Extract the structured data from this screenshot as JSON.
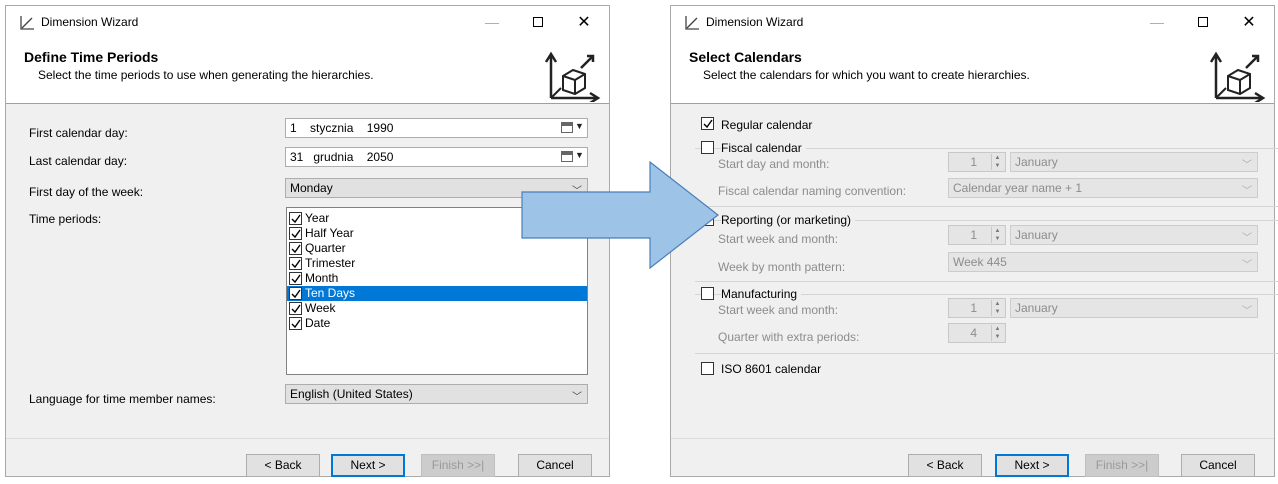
{
  "wizard1": {
    "window_title": "Dimension Wizard",
    "header_title": "Define Time Periods",
    "header_subtitle": "Select the time periods to use when generating the hierarchies.",
    "first_day": {
      "label": "First calendar day:",
      "day": "1",
      "month": "stycznia",
      "year": "1990"
    },
    "last_day": {
      "label": "Last calendar day:",
      "day": "31",
      "month": "grudnia",
      "year": "2050"
    },
    "first_day_of_week": {
      "label": "First day of the week:",
      "value": "Monday"
    },
    "time_periods": {
      "label": "Time periods:",
      "items": [
        {
          "label": "Year",
          "checked": true
        },
        {
          "label": "Half Year",
          "checked": true
        },
        {
          "label": "Quarter",
          "checked": true
        },
        {
          "label": "Trimester",
          "checked": true
        },
        {
          "label": "Month",
          "checked": true
        },
        {
          "label": "Ten Days",
          "checked": true,
          "selected": true
        },
        {
          "label": "Week",
          "checked": true
        },
        {
          "label": "Date",
          "checked": true
        }
      ]
    },
    "language": {
      "label": "Language for time member names:",
      "value": "English (United States)"
    },
    "buttons": {
      "back": "< Back",
      "next": "Next >",
      "finish": "Finish >>|",
      "cancel": "Cancel"
    }
  },
  "wizard2": {
    "window_title": "Dimension Wizard",
    "header_title": "Select Calendars",
    "header_subtitle": "Select the calendars for which you want to create hierarchies.",
    "regular": {
      "label": "Regular calendar",
      "checked": true
    },
    "fiscal": {
      "label": "Fiscal calendar",
      "checked": false,
      "start_label": "Start day and month:",
      "start_day": "1",
      "start_month": "January",
      "naming_label": "Fiscal calendar naming convention:",
      "naming_value": "Calendar year name + 1"
    },
    "reporting": {
      "label": "Reporting (or marketing)",
      "checked": false,
      "start_label": "Start week and month:",
      "start_week": "1",
      "start_month": "January",
      "pattern_label": "Week by month pattern:",
      "pattern_value": "Week 445"
    },
    "manufacturing": {
      "label": "Manufacturing",
      "checked": false,
      "start_label": "Start week and month:",
      "start_week": "1",
      "start_month": "January",
      "quarter_label": "Quarter with extra periods:",
      "quarter_value": "4"
    },
    "iso": {
      "label": "ISO 8601 calendar",
      "checked": false
    },
    "buttons": {
      "back": "< Back",
      "next": "Next >",
      "finish": "Finish >>|",
      "cancel": "Cancel"
    }
  },
  "colors": {
    "selection": "#0078d7",
    "arrow_fill": "#9dc3e6",
    "arrow_stroke": "#4a7ebb"
  }
}
